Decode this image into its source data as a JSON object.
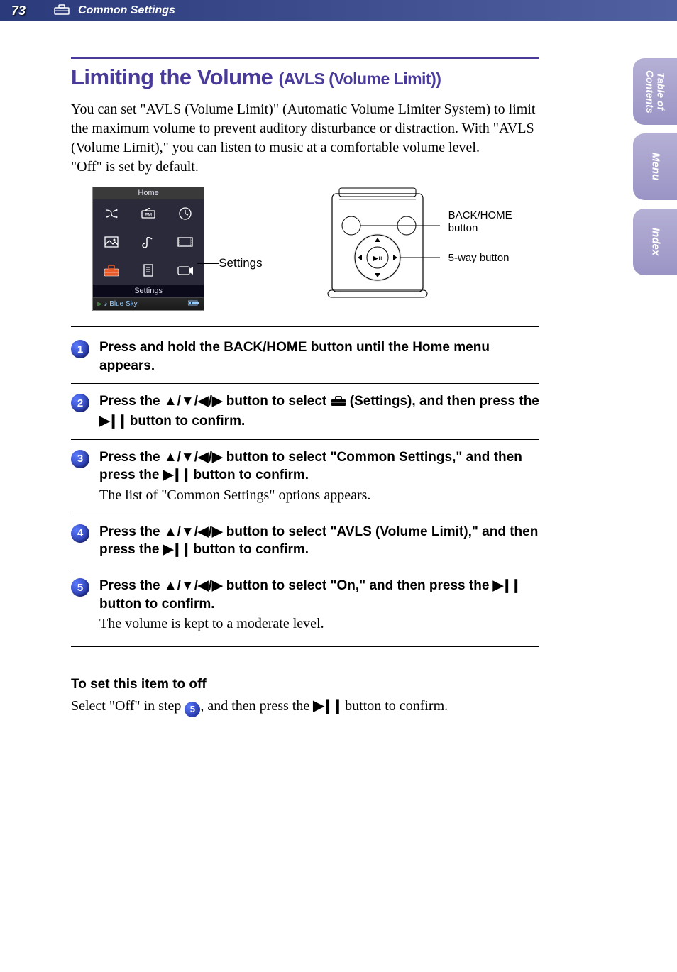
{
  "header": {
    "page_number": "73",
    "section": "Common Settings"
  },
  "title": {
    "main": "Limiting the Volume",
    "sub": "(AVLS (Volume Limit))"
  },
  "intro_lines": [
    "You can set \"AVLS (Volume Limit)\" (Automatic Volume Limiter System) to limit the maximum volume to prevent auditory disturbance or distraction. With \"AVLS (Volume Limit),\" you can listen to music at a comfortable volume level.",
    "\"Off\" is set by default."
  ],
  "screen_mock": {
    "title": "Home",
    "label": "Settings",
    "now_playing_prefix": "♪",
    "now_playing": "Blue Sky",
    "pointer_label": "Settings"
  },
  "device_labels": {
    "back_home": "BACK/HOME button",
    "five_way": "5-way button"
  },
  "steps": [
    {
      "num": "1",
      "action_html": "Press and hold the BACK/HOME button until the Home menu appears.",
      "note": ""
    },
    {
      "num": "2",
      "action_pre": "Press the ",
      "action_arrows": "▲/▼/◀/▶",
      "action_mid": " button to select ",
      "action_icon": "toolbox",
      "action_post": " (Settings), and then press the ",
      "action_play": "▶❙❙",
      "action_end": " button to confirm.",
      "note": ""
    },
    {
      "num": "3",
      "action_pre": "Press the ",
      "action_arrows": "▲/▼/◀/▶",
      "action_mid": " button to select \"Common Settings,\" and then press the ",
      "action_play": "▶❙❙",
      "action_end": " button to confirm.",
      "note": "The list of \"Common Settings\" options appears."
    },
    {
      "num": "4",
      "action_pre": "Press the ",
      "action_arrows": "▲/▼/◀/▶",
      "action_mid": " button to select \"AVLS (Volume Limit),\" and then press the ",
      "action_play": "▶❙❙",
      "action_end": " button to confirm.",
      "note": ""
    },
    {
      "num": "5",
      "action_pre": "Press the ",
      "action_arrows": "▲/▼/◀/▶",
      "action_mid": " button to select \"On,\" and then press the ",
      "action_play": "▶❙❙",
      "action_end": " button to confirm.",
      "note": "The volume is kept to a moderate level."
    }
  ],
  "subsection": {
    "heading": "To set this item to off",
    "text_pre": "Select \"Off\" in step ",
    "step_ref": "5",
    "text_mid": ", and then press the ",
    "play": "▶❙❙",
    "text_end": " button to confirm."
  },
  "side_tabs": [
    "Table of Contents",
    "Menu",
    "Index"
  ]
}
